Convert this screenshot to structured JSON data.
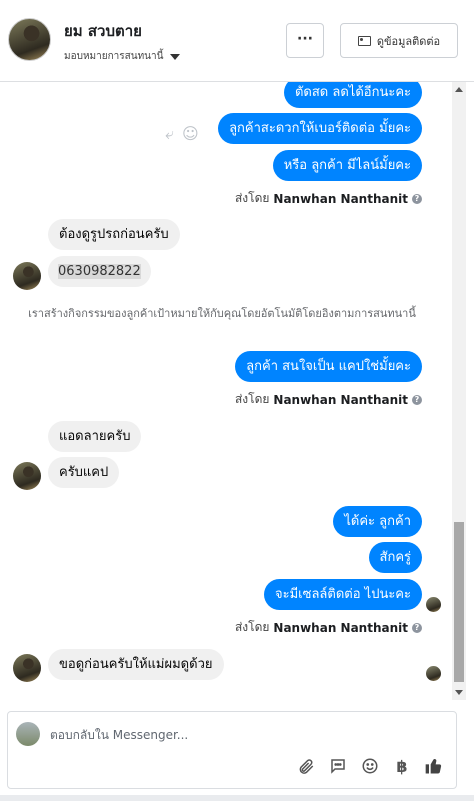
{
  "header": {
    "name": "ยม สวบตาย",
    "assign_label": "มอบหมายการสนทนานี้",
    "more_label": "···",
    "contact_label": "ดูข้อมูลติดต่อ"
  },
  "messages": {
    "out1": "ตัดสด ลดได้อีกนะคะ",
    "out2": "ลูกค้าสะดวกให้เบอร์ติดต่อ มั้ยคะ",
    "out3": "หรือ ลูกค้า มีไลน์มั้ยคะ",
    "in1": "ต้องดูรูปรถก่อนครับ",
    "in2": "0630982822",
    "notice": "เราสร้างกิจกรรมของลูกค้าเป้าหมายให้กับคุณโดยอัตโนมัติโดยอิงตามการสนทนานี้",
    "out4": "ลูกค้า สนใจเป็น แคปใช่มั้ยคะ",
    "in3": "แอดลายครับ",
    "in4": "ครับแคป",
    "out5": "ได้ค่ะ ลูกค้า",
    "out6": "สักครู่",
    "out7": "จะมีเซลล์ติดต่อ ไปนะคะ",
    "in5": "ขอดูก่อนครับให้แม่ผมดูด้วย"
  },
  "sent_by": {
    "prefix": "ส่งโดย",
    "agent": "Nanwhan Nanthanit"
  },
  "composer": {
    "placeholder": "ตอบกลับใน Messenger..."
  },
  "icons": [
    "reply-icon",
    "emoji-icon",
    "attach-icon",
    "saved-reply-icon",
    "emoji-picker-icon",
    "currency-icon",
    "like-icon",
    "help-icon"
  ]
}
